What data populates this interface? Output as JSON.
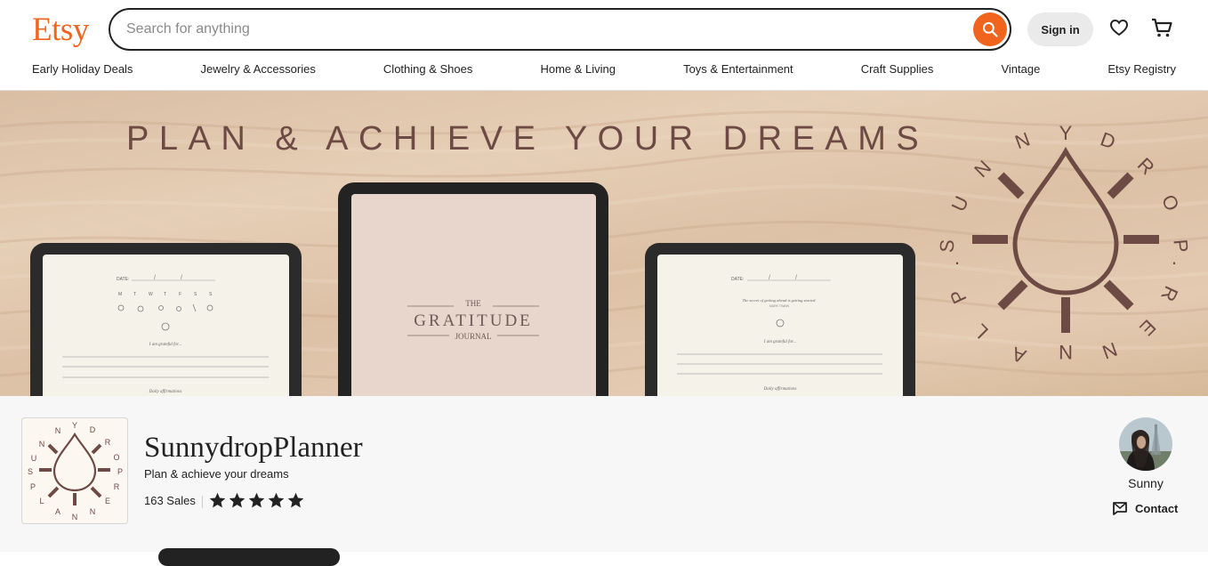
{
  "header": {
    "logo": "Etsy",
    "search_placeholder": "Search for anything",
    "signin_label": "Sign in",
    "icons": [
      "search-icon",
      "heart-icon",
      "cart-icon"
    ]
  },
  "nav": {
    "items": [
      "Early Holiday Deals",
      "Jewelry & Accessories",
      "Clothing & Shoes",
      "Home & Living",
      "Toys & Entertainment",
      "Craft Supplies",
      "Vintage",
      "Etsy Registry"
    ]
  },
  "banner": {
    "headline": "PLAN & ACHIEVE YOUR DREAMS",
    "brand_ring": "SUNNYDROP · PLANNER",
    "left_tablet": {
      "date_label": "DATE:",
      "weekdays": [
        "M",
        "T",
        "W",
        "T",
        "F",
        "S",
        "S"
      ],
      "prompt": "I am grateful for...",
      "footer": "Daily affirmations"
    },
    "center_tablet": {
      "the": "THE",
      "title": "GRATITUDE",
      "subtitle": "JOURNAL"
    },
    "right_tablet": {
      "date_label": "DATE:",
      "quote": "The secret of getting ahead is getting started.",
      "quote_author": "MARK TWAIN",
      "prompt": "I am grateful for...",
      "footer": "Daily affirmations"
    }
  },
  "shop": {
    "name": "SunnydropPlanner",
    "tagline": "Plan & achieve your dreams",
    "sales": "163 Sales",
    "rating": 5,
    "owner_name": "Sunny",
    "contact_label": "Contact"
  },
  "colors": {
    "brand": "#f1641e",
    "text": "#222222",
    "logo_brown": "#6e4a44"
  }
}
